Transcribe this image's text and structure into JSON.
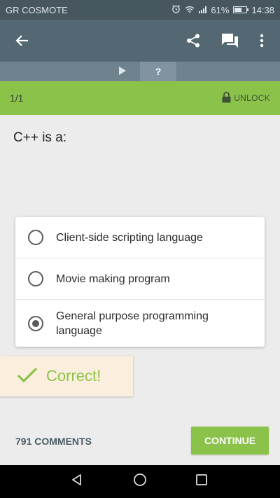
{
  "status_bar": {
    "carrier": "GR COSMOTE",
    "battery_percent_label": "61%",
    "battery_level": 0.61,
    "time": "14:38",
    "icons": [
      "alarm-icon",
      "wifi-icon",
      "signal-icon",
      "battery-icon"
    ]
  },
  "app_bar": {
    "icons": [
      "back-arrow-icon",
      "share-icon",
      "comments-icon",
      "more-vert-icon"
    ]
  },
  "tabs": {
    "play_icon": "play-icon",
    "current_label": "?"
  },
  "progress": {
    "label": "1/1",
    "unlock_label": "UNLOCK",
    "unlock_icon": "lock-icon"
  },
  "question": {
    "text": "C++ is a:"
  },
  "options": [
    {
      "label": "Client-side scripting language",
      "selected": false
    },
    {
      "label": "Movie making program",
      "selected": false
    },
    {
      "label": "General purpose programming language",
      "selected": true
    }
  ],
  "feedback": {
    "text": "Correct!",
    "icon": "checkmark-icon"
  },
  "footer": {
    "comments_label": "791 COMMENTS",
    "continue_label": "CONTINUE"
  },
  "colors": {
    "accent_green": "#8bc34a",
    "app_bar": "#536872",
    "status_bar": "#46575f"
  }
}
